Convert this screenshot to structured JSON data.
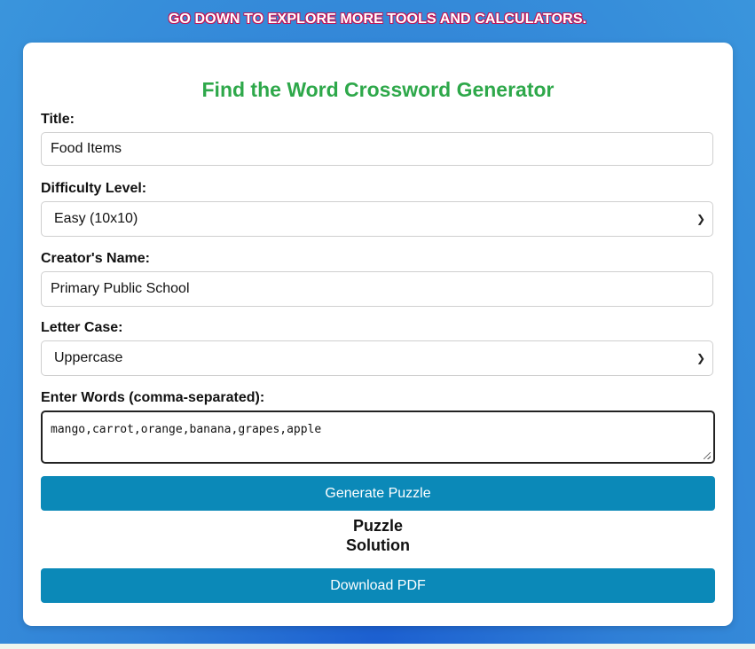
{
  "banner": "GO DOWN TO EXPLORE MORE TOOLS AND CALCULATORS.",
  "title": "Find the Word Crossword Generator",
  "form": {
    "title_label": "Title:",
    "title_value": "Food Items",
    "difficulty_label": "Difficulty Level:",
    "difficulty_value": "Easy (10x10)",
    "creator_label": "Creator's Name:",
    "creator_value": "Primary Public School",
    "case_label": "Letter Case:",
    "case_value": "Uppercase",
    "words_label": "Enter Words (comma-separated):",
    "words_value": "mango,carrot,orange,banana,grapes,apple"
  },
  "buttons": {
    "generate": "Generate Puzzle",
    "download": "Download PDF"
  },
  "sections": {
    "puzzle": "Puzzle",
    "solution": "Solution"
  },
  "colors": {
    "accent": "#2ea84a",
    "button": "#0b89b8"
  }
}
